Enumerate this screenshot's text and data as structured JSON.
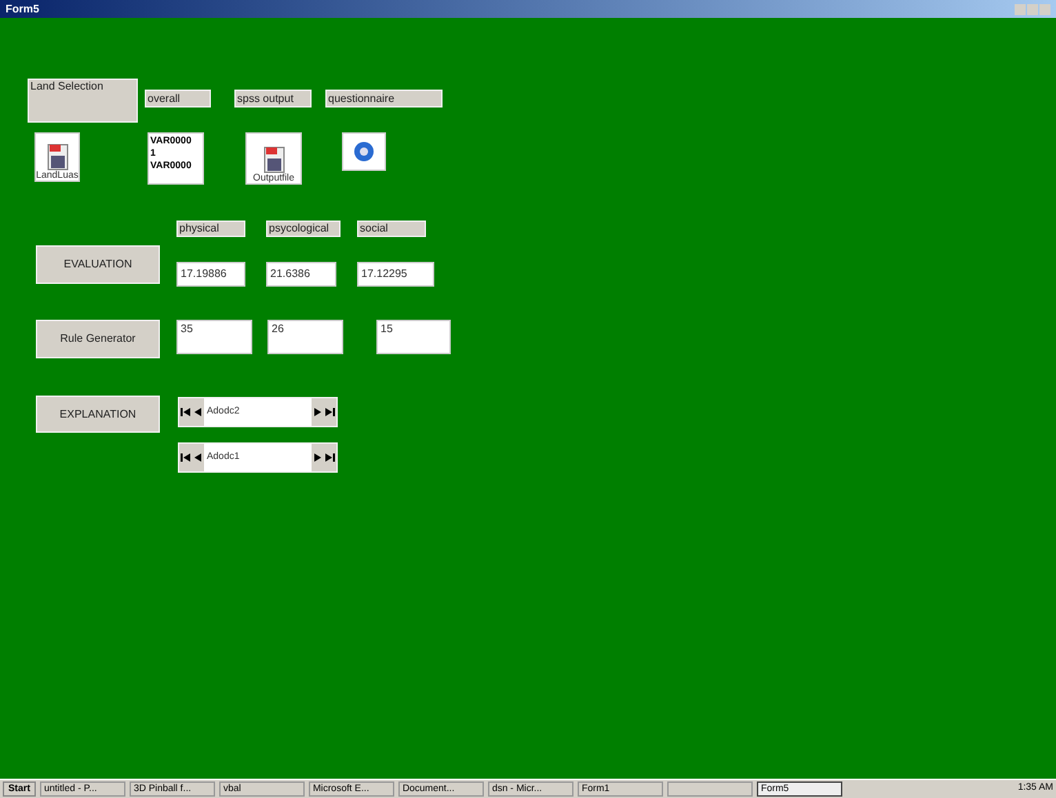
{
  "window": {
    "title": "Form5"
  },
  "land_selection": "Land Selection",
  "header_labels": [
    "overall",
    "spss output",
    "questionnaire"
  ],
  "tiles": [
    {
      "kind": "document",
      "caption": "LandLuas"
    },
    {
      "kind": "text",
      "lines": [
        "VAR0000",
        "1",
        "VAR0000"
      ]
    },
    {
      "kind": "document",
      "caption": "Outputfile"
    },
    {
      "kind": "globe"
    }
  ],
  "score_labels": [
    "physical",
    "psycological",
    "social"
  ],
  "evaluation": {
    "button": "EVALUATION",
    "values": [
      "17.19886",
      "21.6386",
      "17.12295"
    ]
  },
  "rule_generator": {
    "button": "Rule Generator",
    "values": [
      "35",
      "26",
      "15"
    ]
  },
  "explanation": {
    "button": "EXPLANATION",
    "data_controls": [
      "Adodc2",
      "Adodc1"
    ]
  },
  "taskbar": {
    "start": "Start",
    "items": [
      {
        "label": "untitled - P...",
        "selected": false
      },
      {
        "label": "3D Pinball f...",
        "selected": false
      },
      {
        "label": "vbal",
        "selected": false
      },
      {
        "label": "Microsoft E...",
        "selected": false
      },
      {
        "label": "Document...",
        "selected": false
      },
      {
        "label": "dsn - Micr...",
        "selected": false
      },
      {
        "label": "Form1",
        "selected": false
      },
      {
        "selected": false
      },
      {
        "label": "Form5",
        "selected": true
      }
    ],
    "clock": "1:35 AM"
  }
}
